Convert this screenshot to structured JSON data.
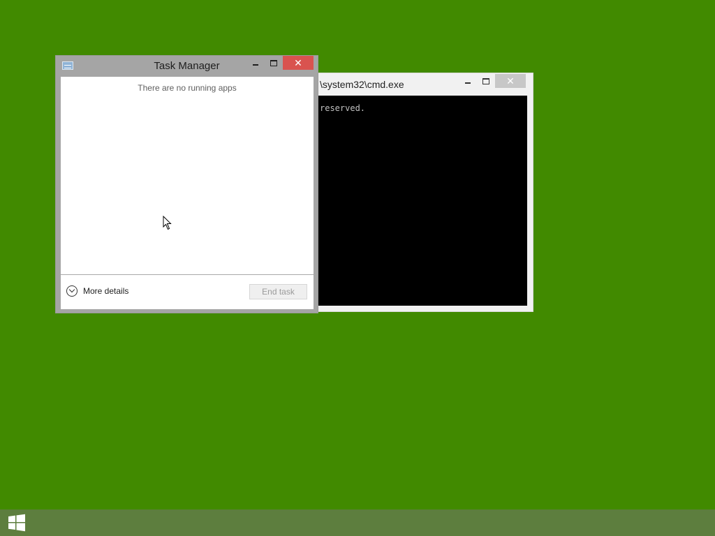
{
  "desktop": {
    "background_color": "#418a00"
  },
  "cmd_window": {
    "title": "\\system32\\cmd.exe",
    "console_text": "reserved.",
    "controls": {
      "minimize_icon": "minimize-icon",
      "maximize_icon": "maximize-icon",
      "close_icon": "close-icon",
      "close_glyph": "✕"
    }
  },
  "task_manager": {
    "title": "Task Manager",
    "app_icon": "task-manager-icon",
    "empty_message": "There are no running apps",
    "more_details_label": "More details",
    "end_task_label": "End task",
    "controls": {
      "close_glyph": "✕",
      "close_color": "#d9534f"
    }
  },
  "taskbar": {
    "start_icon": "windows-logo-icon",
    "color": "#5d7e3e"
  }
}
